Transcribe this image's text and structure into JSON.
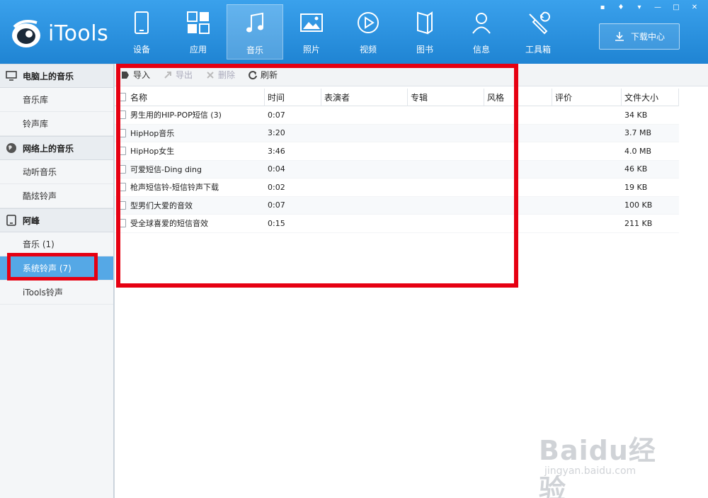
{
  "app": {
    "name": "iTools"
  },
  "nav": [
    {
      "label": "设备",
      "icon": "device-icon"
    },
    {
      "label": "应用",
      "icon": "apps-icon"
    },
    {
      "label": "音乐",
      "icon": "music-icon"
    },
    {
      "label": "照片",
      "icon": "photo-icon"
    },
    {
      "label": "视频",
      "icon": "video-icon"
    },
    {
      "label": "图书",
      "icon": "book-icon"
    },
    {
      "label": "信息",
      "icon": "contacts-icon"
    },
    {
      "label": "工具箱",
      "icon": "toolbox-icon"
    }
  ],
  "download_center": "下载中心",
  "sidebar": {
    "groups": [
      {
        "title": "电脑上的音乐",
        "icon": "computer-icon",
        "items": [
          "音乐库",
          "铃声库"
        ]
      },
      {
        "title": "网络上的音乐",
        "icon": "globe-icon",
        "items": [
          "动听音乐",
          "酷炫铃声"
        ]
      },
      {
        "title": "阿峰",
        "icon": "phone-icon",
        "items": [
          "音乐 (1)",
          "系统铃声 (7)",
          "iTools铃声"
        ]
      }
    ],
    "selected": "系统铃声 (7)"
  },
  "toolbar": {
    "import": "导入",
    "export": "导出",
    "delete": "删除",
    "refresh": "刷新"
  },
  "table": {
    "headers": [
      "名称",
      "时间",
      "表演者",
      "专辑",
      "风格",
      "评价",
      "文件大小"
    ],
    "rows": [
      {
        "name": "男生用的HIP-POP短信 (3)",
        "time": "0:07",
        "size": "34 KB"
      },
      {
        "name": "HipHop音乐",
        "time": "3:20",
        "size": "3.7 MB"
      },
      {
        "name": "HipHop女生",
        "time": "3:46",
        "size": "4.0 MB"
      },
      {
        "name": "可爱短信-Ding ding",
        "time": "0:04",
        "size": "46 KB"
      },
      {
        "name": "枪声短信铃-短信铃声下载",
        "time": "0:02",
        "size": "19 KB"
      },
      {
        "name": "型男们大爱的音效",
        "time": "0:07",
        "size": "100 KB"
      },
      {
        "name": "受全球喜爱的短信音效",
        "time": "0:15",
        "size": "211 KB"
      }
    ]
  },
  "watermark": {
    "text": "Baidu经验",
    "sub": "jingyan.baidu.com"
  },
  "colors": {
    "header": "#2d8bd6",
    "selected": "#55a8e6",
    "highlight": "#e60012"
  }
}
